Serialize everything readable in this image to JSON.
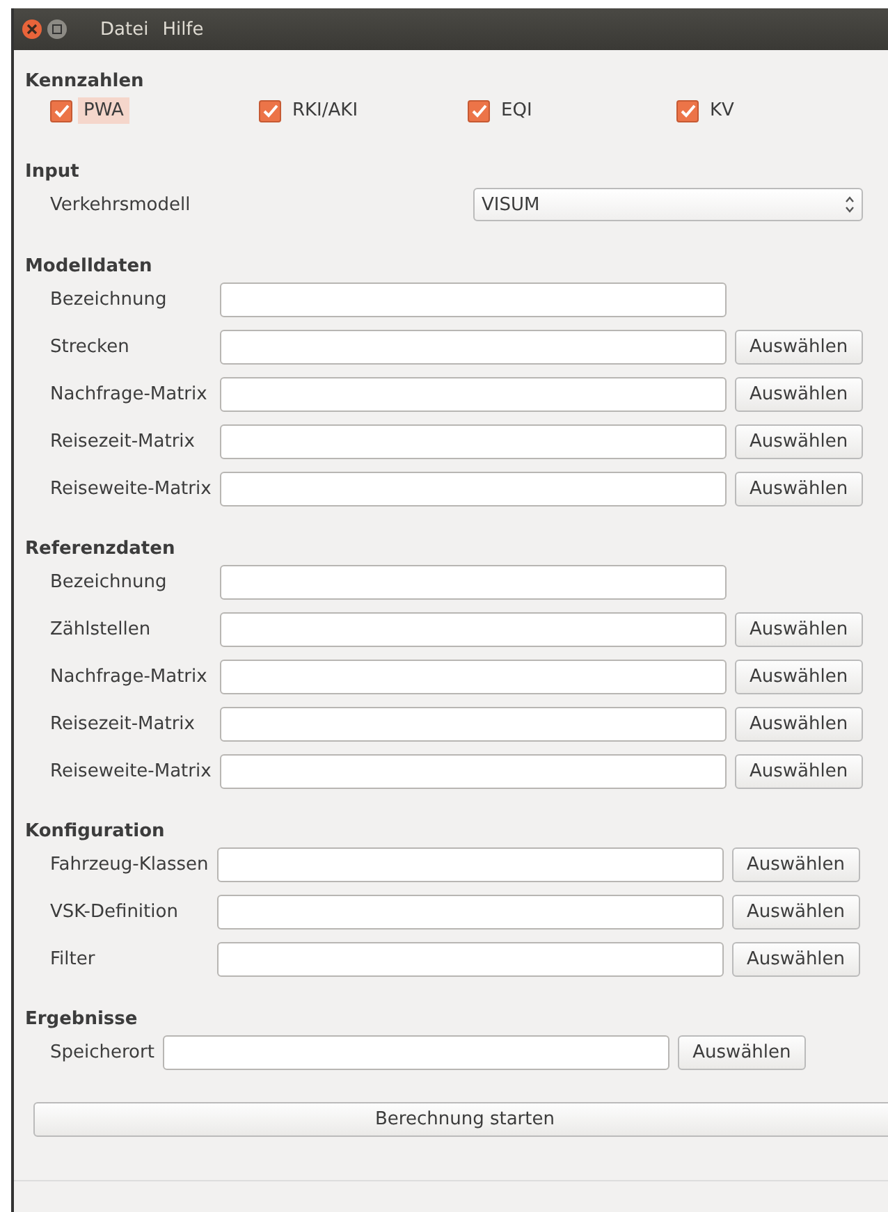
{
  "menu": [
    "Datei",
    "Hilfe"
  ],
  "kennzahlen": {
    "title": "Kennzahlen",
    "items": [
      {
        "label": "PWA",
        "checked": true,
        "selected": true
      },
      {
        "label": "RKI/AKI",
        "checked": true,
        "selected": false
      },
      {
        "label": "EQI",
        "checked": true,
        "selected": false
      },
      {
        "label": "KV",
        "checked": true,
        "selected": false
      }
    ]
  },
  "input": {
    "title": "Input",
    "label": "Verkehrsmodell",
    "value": "VISUM"
  },
  "sections": [
    {
      "title": "Modelldaten",
      "rows": [
        {
          "label": "Bezeichnung"
        },
        {
          "label": "Strecken",
          "button": "Auswählen"
        },
        {
          "label": "Nachfrage-Matrix",
          "button": "Auswählen"
        },
        {
          "label": "Reisezeit-Matrix",
          "button": "Auswählen"
        },
        {
          "label": "Reiseweite-Matrix",
          "button": "Auswählen"
        }
      ]
    },
    {
      "title": "Referenzdaten",
      "rows": [
        {
          "label": "Bezeichnung"
        },
        {
          "label": "Zählstellen",
          "button": "Auswählen"
        },
        {
          "label": "Nachfrage-Matrix",
          "button": "Auswählen"
        },
        {
          "label": "Reisezeit-Matrix",
          "button": "Auswählen"
        },
        {
          "label": "Reiseweite-Matrix",
          "button": "Auswählen"
        }
      ]
    },
    {
      "title": "Konfiguration",
      "rows": [
        {
          "label": "Fahrzeug-Klassen",
          "button": "Auswählen"
        },
        {
          "label": "VSK-Definition",
          "button": "Auswählen"
        },
        {
          "label": "Filter",
          "button": "Auswählen"
        }
      ]
    },
    {
      "title": "Ergebnisse",
      "rows": [
        {
          "label": "Speicherort",
          "button": "Auswählen"
        }
      ]
    }
  ],
  "start_button": "Berechnung starten"
}
